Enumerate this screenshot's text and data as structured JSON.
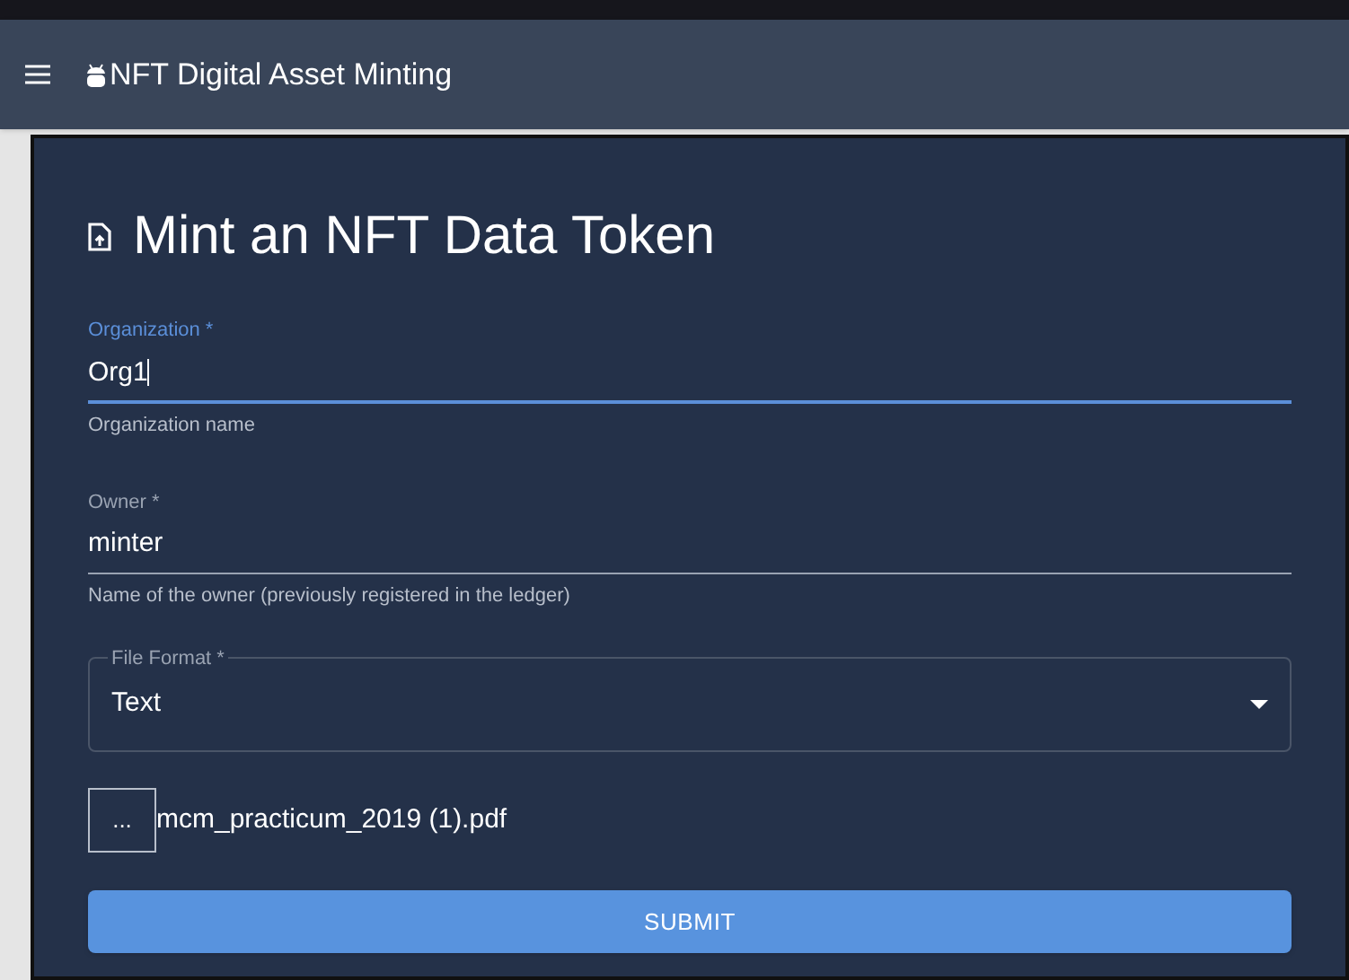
{
  "app_bar": {
    "title": "NFT Digital Asset Minting"
  },
  "form": {
    "title": "Mint an NFT Data Token",
    "fields": [
      {
        "kind": "text",
        "label": "Organization *",
        "value": "Org1",
        "helper": "Organization name",
        "focused": true
      },
      {
        "kind": "text",
        "label": "Owner *",
        "value": "minter",
        "helper": "Name of the owner (previously registered in the ledger)",
        "focused": false
      },
      {
        "kind": "select",
        "label": "File Format *",
        "value": "Text",
        "focused": false
      }
    ],
    "file": {
      "button": "...",
      "name": "mcm_practicum_2019 (1).pdf"
    },
    "submit": "SUBMIT"
  }
}
